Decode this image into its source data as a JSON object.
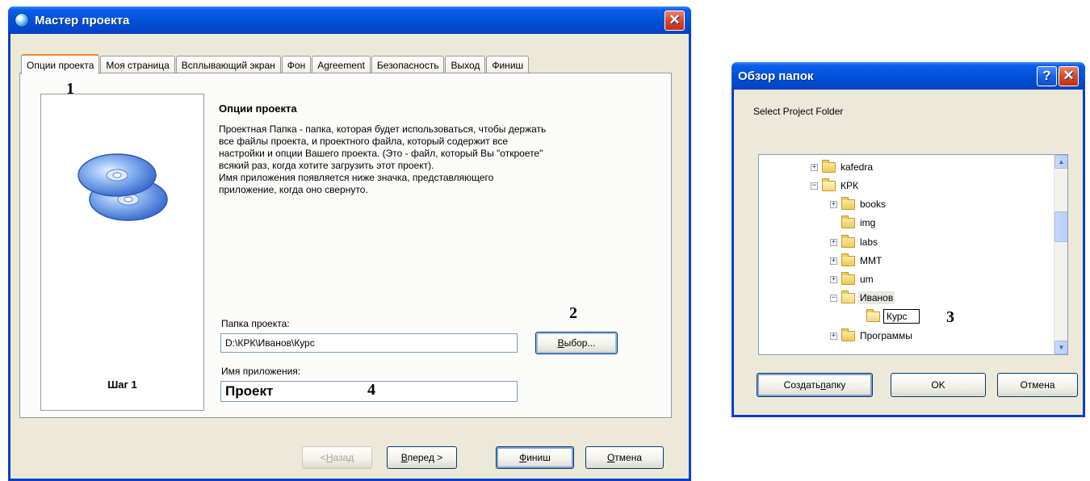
{
  "wizard": {
    "title": "Мастер проекта",
    "close_glyph": "✕",
    "tabs": [
      {
        "label": "Опции проекта"
      },
      {
        "label": "Моя страница"
      },
      {
        "label": "Всплывающий экран"
      },
      {
        "label": "Фон"
      },
      {
        "label": "Agreement"
      },
      {
        "label": "Безопасность"
      },
      {
        "label": "Выход"
      },
      {
        "label": "Финиш"
      }
    ],
    "step_label": "Шаг 1",
    "heading": "Опции проекта",
    "description": [
      "Проектная Папка - папка, которая будет использоваться, чтобы держать",
      "все файлы проекта, и проектного файла, который содержит все",
      "настройки и опции Вашего проекта. (Это - файл, который Вы \"откроете\"",
      "всякий раз, когда хотите загрузить этот проект).",
      "Имя приложения появляется ниже значка, представляющего",
      "приложение, когда оно свернуто."
    ],
    "project_folder_label": "Папка проекта:",
    "project_folder_value": "D:\\КРК\\Иванов\\Курс",
    "browse_button": {
      "key": "В",
      "rest": "ыбор..."
    },
    "app_name_label": "Имя приложения:",
    "app_name_value": "Проект",
    "buttons": {
      "back": {
        "prefix": "< ",
        "key": "Н",
        "rest": "азад"
      },
      "next": {
        "key": "В",
        "rest": "перед >"
      },
      "finish": {
        "key": "Ф",
        "rest": "иниш"
      },
      "cancel": {
        "key": "О",
        "rest": "тмена"
      }
    },
    "annotations": {
      "a1": "1",
      "a2": "2",
      "a4": "4"
    }
  },
  "browse": {
    "title": "Обзор папок",
    "help_glyph": "?",
    "close_glyph": "✕",
    "prompt": "Select Project Folder",
    "tree": [
      {
        "label": "kafedra",
        "expander": "+"
      },
      {
        "label": "КРК",
        "expander": "−"
      },
      {
        "label": "books",
        "expander": "+"
      },
      {
        "label": "img",
        "expander": ""
      },
      {
        "label": "labs",
        "expander": "+"
      },
      {
        "label": "MMT",
        "expander": "+"
      },
      {
        "label": "um",
        "expander": "+"
      },
      {
        "label": "Иванов",
        "expander": "−"
      },
      {
        "label": "Курс",
        "expander": ""
      },
      {
        "label": "Программы",
        "expander": "+"
      }
    ],
    "scroll_up_glyph": "▲",
    "scroll_down_glyph": "▼",
    "buttons": {
      "new_folder": {
        "prefix": "Создать ",
        "key": "п",
        "rest": "апку"
      },
      "ok": "OK",
      "cancel": "Отмена"
    },
    "annotation": "3"
  }
}
